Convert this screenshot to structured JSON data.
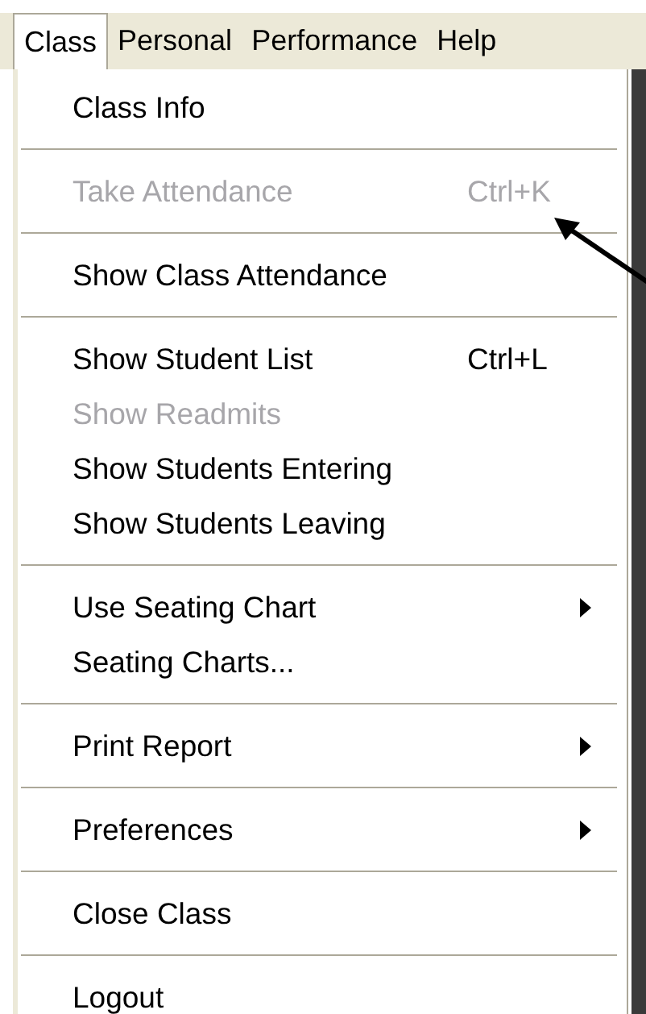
{
  "menu_bar": [
    {
      "label": "Class",
      "selected": true
    },
    {
      "label": "Personal",
      "selected": false
    },
    {
      "label": "Performance",
      "selected": false
    },
    {
      "label": "Help",
      "selected": false
    }
  ],
  "menu": {
    "entries": [
      {
        "kind": "item",
        "label": "Class Info",
        "disabled": false,
        "submenu": false
      },
      {
        "kind": "separator"
      },
      {
        "kind": "item",
        "label": "Take Attendance",
        "shortcut": "Ctrl+K",
        "disabled": true,
        "submenu": false
      },
      {
        "kind": "separator"
      },
      {
        "kind": "item",
        "label": "Show Class Attendance",
        "disabled": false,
        "submenu": false
      },
      {
        "kind": "separator"
      },
      {
        "kind": "item",
        "label": "Show Student List",
        "shortcut": "Ctrl+L",
        "disabled": false,
        "submenu": false
      },
      {
        "kind": "item",
        "label": "Show Readmits",
        "disabled": true,
        "submenu": false
      },
      {
        "kind": "item",
        "label": "Show Students Entering",
        "disabled": false,
        "submenu": false
      },
      {
        "kind": "item",
        "label": "Show Students Leaving",
        "disabled": false,
        "submenu": false
      },
      {
        "kind": "separator"
      },
      {
        "kind": "item",
        "label": "Use Seating Chart",
        "disabled": false,
        "submenu": true
      },
      {
        "kind": "item",
        "label": "Seating Charts...",
        "disabled": false,
        "submenu": false
      },
      {
        "kind": "separator"
      },
      {
        "kind": "item",
        "label": "Print Report",
        "disabled": false,
        "submenu": true
      },
      {
        "kind": "separator"
      },
      {
        "kind": "item",
        "label": "Preferences",
        "disabled": false,
        "submenu": true
      },
      {
        "kind": "separator"
      },
      {
        "kind": "item",
        "label": "Close Class",
        "disabled": false,
        "submenu": false
      },
      {
        "kind": "separator"
      },
      {
        "kind": "item",
        "label": "Logout",
        "disabled": false,
        "submenu": false
      }
    ]
  }
}
